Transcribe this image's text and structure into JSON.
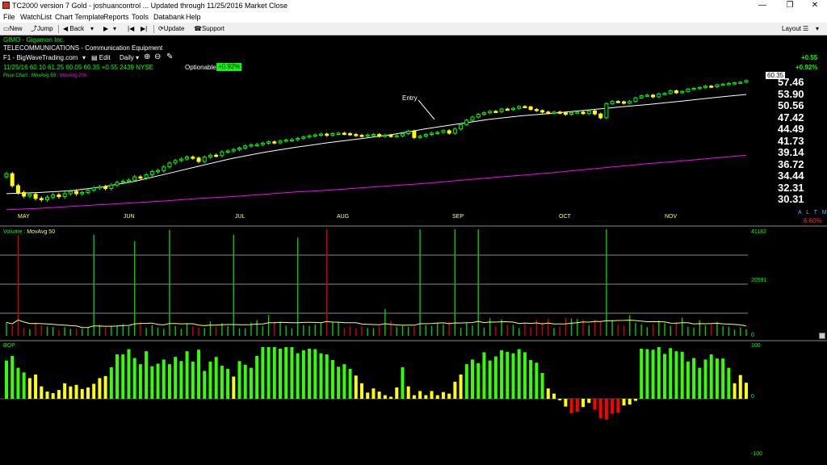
{
  "window": {
    "title": "TC2000 version 7 Gold - joshuancontrol  ... Updated through 11/25/2016  Market Close",
    "minimize": "—",
    "restore": "❐",
    "close": "✕"
  },
  "menu": [
    "File",
    "WatchList",
    "Chart Template",
    "Reports",
    "Tools",
    "Databank",
    "Help"
  ],
  "toolbar": {
    "new": "New",
    "jump": "Jump",
    "back": "Back",
    "update": "Update",
    "support": "Support",
    "layout": "Layout"
  },
  "header": {
    "symbol": "GIMO - Gigamon Inc.",
    "industry": "TELECOMMUNICATIONS - Communication Equipment",
    "layout_name": "F1 - BigWaveTrading.com",
    "edit": "Edit",
    "period": "Daily",
    "quote": "11/25/16   60.10   61.25   60.05  60.35  +0.55  2439  NYSE",
    "optionable": "Optionable",
    "optionable_badge": "+0.92%",
    "change": "+0.55",
    "change_pct": "+0.92%",
    "price_chart_label": "Price Chart",
    "ma50_label": "MovAvg 50",
    "ma200_label": "MovAvg 200",
    "last_price": "60.35",
    "entry_label": "Entry",
    "a_l_t_m": "A L T M",
    "pct_right": "6.60%"
  },
  "price_axis": [
    "57.46",
    "53.90",
    "50.56",
    "47.42",
    "44.49",
    "41.73",
    "39.14",
    "36.72",
    "34.44",
    "32.31",
    "30.31"
  ],
  "months": [
    "MAY",
    "JUN",
    "JUL",
    "AUG",
    "SEP",
    "OCT",
    "NOV"
  ],
  "volume": {
    "label": "Volume",
    "ma_label": "MovAvg 50",
    "axis": [
      "41182",
      "20591",
      "0"
    ]
  },
  "bop": {
    "label": "BOP",
    "axis": [
      "100",
      "0",
      "-100"
    ]
  },
  "chart_data": {
    "type": "candlestick",
    "closes": [
      35.0,
      32.8,
      31.6,
      31.0,
      31.3,
      30.6,
      30.4,
      30.8,
      31.2,
      30.9,
      31.4,
      31.8,
      31.4,
      31.6,
      32.0,
      32.4,
      32.6,
      32.3,
      32.9,
      33.4,
      33.6,
      33.8,
      34.4,
      34.2,
      34.8,
      35.4,
      35.6,
      36.3,
      37.1,
      37.6,
      37.9,
      38.3,
      38.1,
      37.4,
      38.3,
      38.7,
      38.6,
      39.4,
      39.6,
      39.9,
      40.2,
      40.7,
      40.9,
      41.0,
      41.3,
      41.6,
      41.4,
      41.8,
      42.0,
      42.1,
      42.4,
      42.7,
      43.0,
      43.2,
      43.4,
      43.1,
      43.5,
      43.6,
      43.5,
      43.3,
      43.1,
      43.0,
      43.2,
      43.3,
      42.9,
      43.1,
      42.9,
      43.0,
      43.5,
      44.1,
      42.6,
      42.9,
      43.3,
      43.6,
      43.8,
      44.2,
      43.6,
      44.6,
      45.7,
      46.8,
      47.6,
      48.3,
      48.7,
      49.1,
      49.0,
      49.7,
      49.6,
      49.9,
      50.4,
      50.3,
      49.6,
      49.3,
      48.9,
      48.6,
      48.9,
      48.7,
      48.3,
      48.8,
      48.9,
      48.5,
      49.2,
      48.4,
      47.4,
      51.2,
      51.8,
      51.7,
      51.3,
      51.8,
      52.8,
      53.4,
      53.6,
      53.1,
      54.0,
      54.1,
      54.9,
      54.3,
      54.7,
      55.4,
      55.6,
      55.9,
      56.3,
      56.1,
      56.7,
      56.9,
      57.1,
      57.3,
      57.5,
      58.0
    ],
    "ma50": [
      31.4,
      31.6,
      31.9,
      32.6,
      33.6,
      35.0,
      36.5,
      38.0,
      39.3,
      40.4,
      41.4,
      42.3,
      43.3,
      44.6,
      45.8,
      47.0,
      47.9,
      48.6,
      49.4,
      50.2,
      51.0,
      51.9,
      52.9,
      53.8
    ],
    "ma200": [
      28.8,
      29.0,
      29.3,
      29.6,
      29.9,
      30.2,
      30.6,
      30.9,
      31.3,
      31.7,
      32.0,
      32.4,
      32.8,
      33.2,
      33.7,
      34.2,
      34.7,
      35.2,
      35.8,
      36.4,
      37.0,
      37.5,
      38.1,
      38.7
    ],
    "ylim": [
      30.31,
      57.46
    ],
    "volume_peak": 41182,
    "bop_range": [
      -100,
      100
    ],
    "volume": [
      5200,
      4100,
      39000,
      3000,
      2600,
      5000,
      4100,
      3600,
      3500,
      2200,
      3300,
      2700,
      2800,
      2700,
      3300,
      39000,
      4300,
      3300,
      3900,
      4000,
      4500,
      3700,
      36500,
      5200,
      3100,
      4200,
      3200,
      2700,
      41000,
      3800,
      2700,
      4900,
      3600,
      3200,
      3000,
      5600,
      3500,
      4900,
      3800,
      39000,
      2900,
      2900,
      5200,
      6100,
      3700,
      8100,
      5500,
      5400,
      3900,
      2900,
      38000,
      4100,
      3900,
      4400,
      5000,
      41182,
      5300,
      5200,
      3000,
      3700,
      2900,
      3700,
      3000,
      3000,
      3700,
      10400,
      5800,
      3500,
      3800,
      3400,
      3500,
      41182,
      4100,
      3800,
      4900,
      4400,
      5500,
      41182,
      3100,
      4900,
      4000,
      41182,
      3200,
      6800,
      3700,
      6400,
      4200,
      4200,
      3000,
      5000,
      3300,
      6200,
      5200,
      6600,
      3000,
      3500,
      7000,
      6700,
      6500,
      6400,
      4000,
      6300,
      5400,
      41182,
      6100,
      4300,
      4000,
      8000,
      5000,
      4400,
      3400,
      4400,
      5900,
      4900,
      3900,
      5200,
      7000,
      3500,
      3200,
      6000,
      4000,
      4600,
      5300,
      3700,
      3500,
      2400,
      3300,
      2500
    ],
    "bop": [
      74,
      83,
      60,
      51,
      40,
      47,
      24,
      14,
      11,
      17,
      30,
      24,
      27,
      19,
      22,
      29,
      40,
      44,
      61,
      86,
      86,
      96,
      79,
      67,
      92,
      63,
      68,
      76,
      67,
      81,
      73,
      92,
      72,
      95,
      54,
      72,
      81,
      64,
      58,
      43,
      73,
      66,
      60,
      83,
      100,
      100,
      100,
      97,
      100,
      100,
      88,
      94,
      97,
      96,
      88,
      86,
      75,
      62,
      67,
      58,
      45,
      30,
      12,
      20,
      14,
      7,
      4,
      22,
      61,
      24,
      7,
      15,
      7,
      15,
      7,
      13,
      10,
      33,
      47,
      67,
      76,
      69,
      90,
      74,
      82,
      94,
      91,
      88,
      96,
      90,
      75,
      70,
      50,
      20,
      10,
      -3,
      -15,
      -28,
      -25,
      -16,
      -8,
      -21,
      -38,
      -40,
      -29,
      -27,
      -13,
      -11,
      -4,
      97,
      96,
      95,
      100,
      87,
      98,
      92,
      91,
      72,
      79,
      60,
      76,
      86,
      78,
      78,
      60,
      30,
      46,
      31
    ]
  }
}
